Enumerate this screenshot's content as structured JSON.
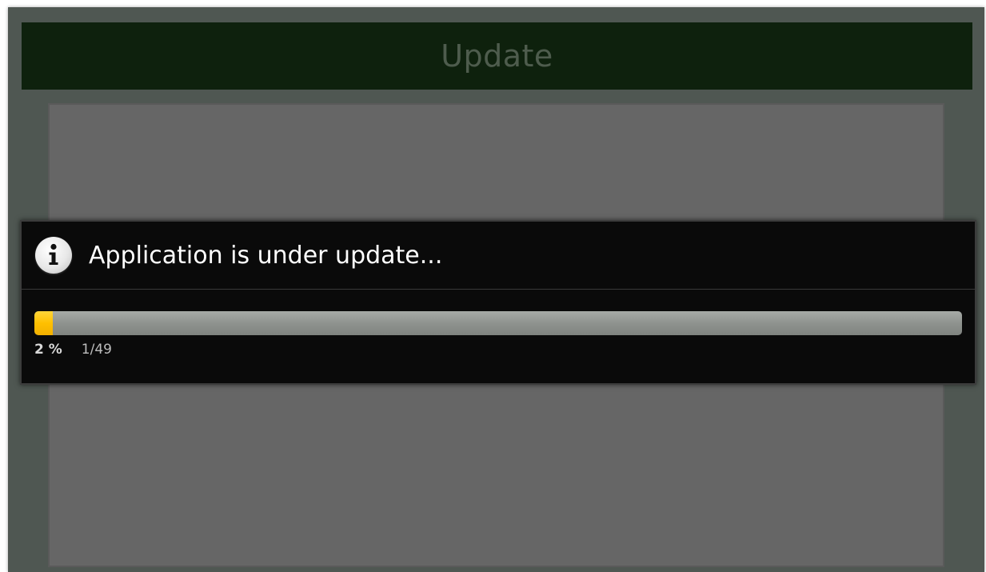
{
  "app": {
    "title": "Update"
  },
  "dialog": {
    "icon": "info-icon",
    "message": "Application is under update...",
    "progress": {
      "fraction": 0.02,
      "percent_label": "2 %",
      "count_label": "1/49"
    }
  },
  "colors": {
    "title_bar_bg": "#0e210d",
    "title_text": "#4e5c4d",
    "progress_fill": "#ffc000",
    "progress_track": "#8f938f",
    "dialog_bg": "#0a0a0a",
    "panel_bg": "#666666"
  }
}
